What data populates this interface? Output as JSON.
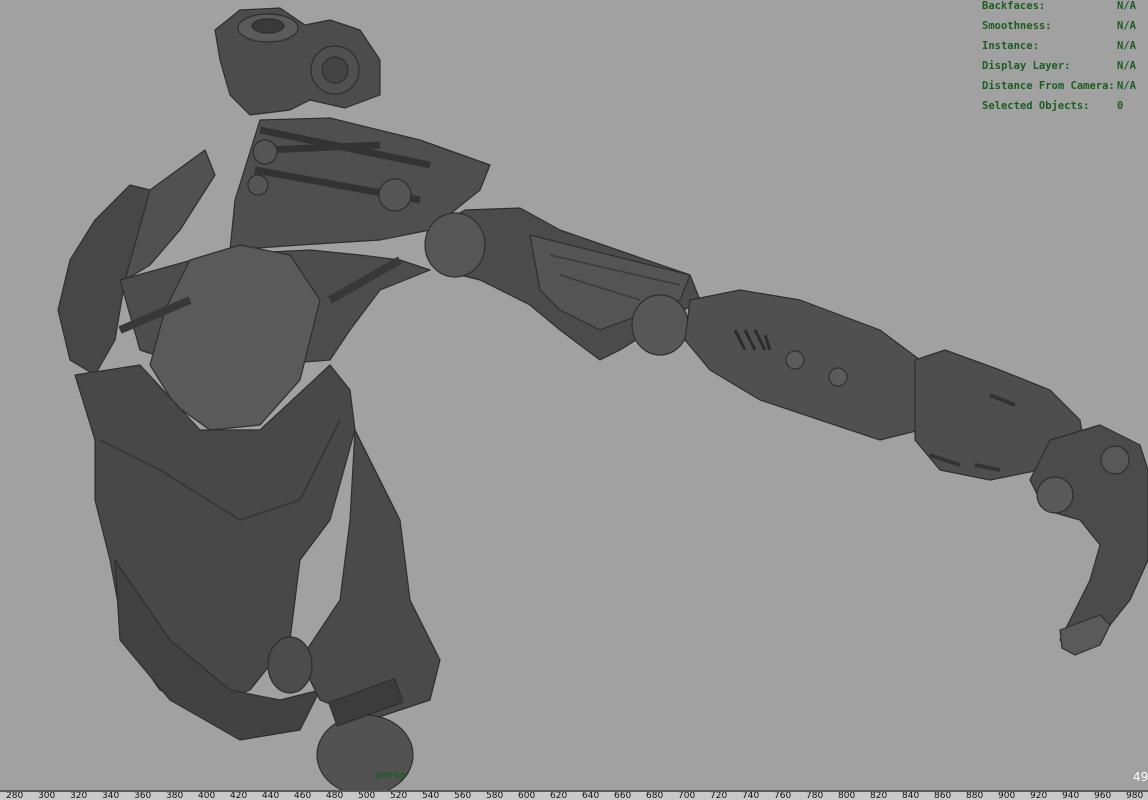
{
  "hud": {
    "rows": [
      {
        "label": "Backfaces:",
        "value": "N/A"
      },
      {
        "label": "Smoothness:",
        "value": "N/A"
      },
      {
        "label": "Instance:",
        "value": "N/A"
      },
      {
        "label": "Display Layer:",
        "value": "N/A"
      },
      {
        "label": "Distance From Camera:",
        "value": "N/A"
      },
      {
        "label": "Selected Objects:",
        "value": "0"
      }
    ]
  },
  "camera": {
    "name": "persp"
  },
  "frame": {
    "current": "49"
  },
  "timeline": {
    "ticks": [
      "280",
      "300",
      "320",
      "340",
      "360",
      "380",
      "400",
      "420",
      "440",
      "460",
      "480",
      "500",
      "520",
      "540",
      "560",
      "580",
      "600",
      "620",
      "640",
      "660",
      "680",
      "700",
      "720",
      "740",
      "760",
      "780",
      "800",
      "820",
      "840",
      "860",
      "880",
      "900",
      "920",
      "940",
      "960",
      "980"
    ]
  },
  "colors": {
    "viewport_bg": "#a1a1a1",
    "hud_text": "#1b5e20",
    "model": "#4a4a4a"
  }
}
